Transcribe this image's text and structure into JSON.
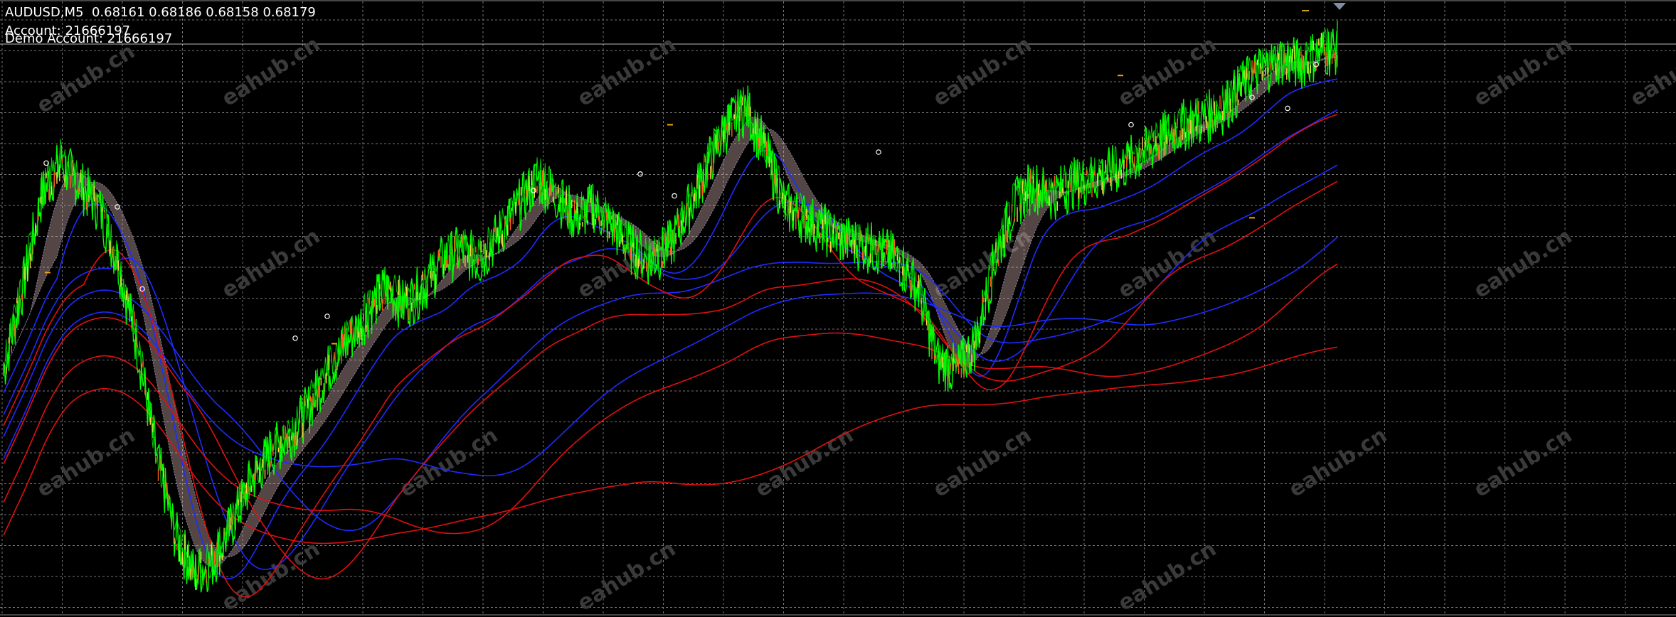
{
  "chart_header": {
    "symbol": "AUDUSD,M5",
    "ohlc": "0.68161 0.68186 0.68158 0.68179"
  },
  "account": {
    "account_label": "Account:",
    "account_number": "21666197",
    "demo_label": "Demo Account:",
    "demo_number": "21666197"
  },
  "watermark": {
    "text": "eahub.cn"
  },
  "colors": {
    "background": "#000000",
    "grid": "#8a8a8a",
    "price": "#00ff00",
    "candles_up": "#ff5a1f",
    "candles_down": "#ffd24a",
    "ma_blue": "#1f2bff",
    "ma_red": "#e01010",
    "cloud": "#f4c8c8",
    "cloud_alt": "#c8c8ff"
  },
  "chart_data": {
    "type": "line",
    "title": "",
    "symbol": "AUDUSD",
    "timeframe": "M5",
    "grid": true,
    "series": [
      {
        "name": "",
        "role": "price",
        "values": [
          0.4,
          0.55,
          0.72,
          0.78,
          0.74,
          0.7,
          0.6,
          0.45,
          0.25,
          0.1,
          0.03,
          0.05,
          0.12,
          0.2,
          0.25,
          0.28,
          0.33,
          0.4,
          0.45,
          0.5,
          0.55,
          0.52,
          0.55,
          0.6,
          0.62,
          0.6,
          0.65,
          0.7,
          0.75,
          0.72,
          0.68,
          0.7,
          0.66,
          0.62,
          0.6,
          0.63,
          0.7,
          0.78,
          0.85,
          0.88,
          0.8,
          0.7,
          0.68,
          0.66,
          0.64,
          0.63,
          0.62,
          0.6,
          0.55,
          0.42,
          0.4,
          0.45,
          0.6,
          0.7,
          0.74,
          0.72,
          0.74,
          0.75,
          0.76,
          0.78,
          0.8,
          0.83,
          0.85,
          0.86,
          0.88,
          0.92,
          0.95,
          0.97,
          0.96,
          0.98,
          0.99
        ]
      }
    ]
  }
}
